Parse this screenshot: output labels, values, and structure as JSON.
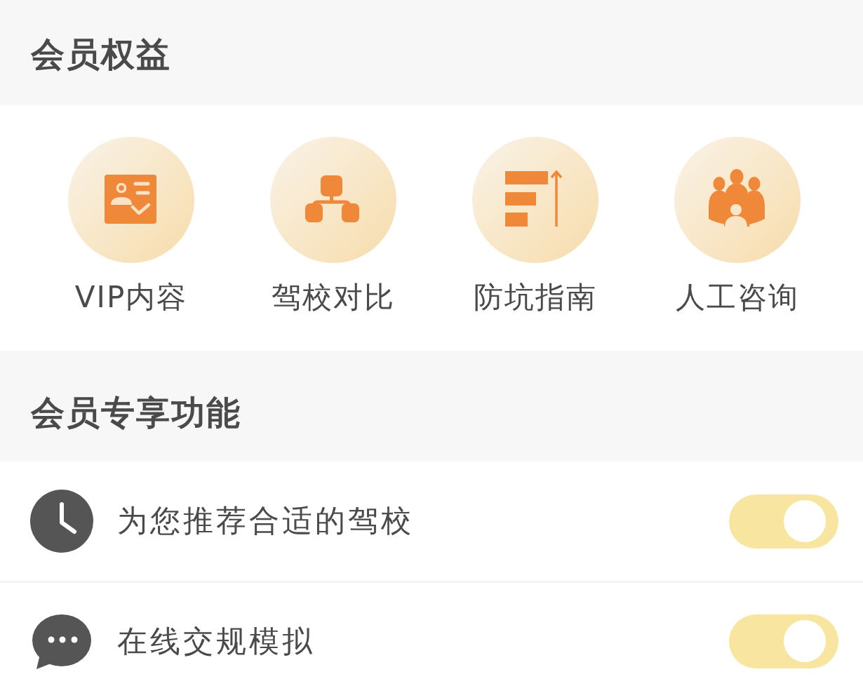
{
  "benefits": {
    "title": "会员权益",
    "items": [
      {
        "label": "VIP内容"
      },
      {
        "label": "驾校对比"
      },
      {
        "label": "防坑指南"
      },
      {
        "label": "人工咨询"
      }
    ]
  },
  "features": {
    "title": "会员专享功能",
    "items": [
      {
        "label": "为您推荐合适的驾校",
        "on": true
      },
      {
        "label": "在线交规模拟",
        "on": true
      }
    ]
  }
}
